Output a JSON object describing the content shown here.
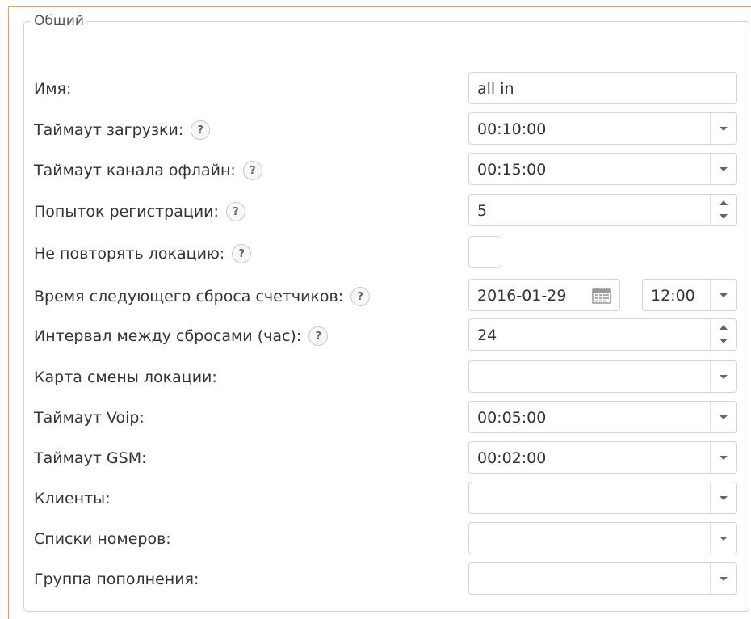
{
  "legend": "Общий",
  "fields": {
    "name": {
      "label": "Имя:",
      "value": "all in"
    },
    "load_timeout": {
      "label": "Таймаут загрузки:",
      "help": "?",
      "value": "00:10:00"
    },
    "channel_offline_timeout": {
      "label": "Таймаут канала офлайн:",
      "help": "?",
      "value": "00:15:00"
    },
    "registration_attempts": {
      "label": "Попыток регистрации:",
      "help": "?",
      "value": "5"
    },
    "no_repeat_location": {
      "label": "Не повторять локацию:",
      "help": "?",
      "checked": false
    },
    "next_counter_reset": {
      "label": "Время следующего сброса счетчиков:",
      "help": "?",
      "date": "2016-01-29",
      "time": "12:00"
    },
    "reset_interval": {
      "label": "Интервал между сбросами (час):",
      "help": "?",
      "value": "24"
    },
    "location_change_map": {
      "label": "Карта смены локации:",
      "value": ""
    },
    "voip_timeout": {
      "label": "Таймаут Voip:",
      "value": "00:05:00"
    },
    "gsm_timeout": {
      "label": "Таймаут GSM:",
      "value": "00:02:00"
    },
    "clients": {
      "label": "Клиенты:",
      "value": ""
    },
    "number_lists": {
      "label": "Списки номеров:",
      "value": ""
    },
    "top_up_group": {
      "label": "Группа пополнения:",
      "value": ""
    }
  },
  "icons": {
    "help": "question-circle-icon",
    "dropdown": "chevron-down-icon",
    "spinner": "spinner-arrows-icon",
    "calendar": "calendar-icon"
  },
  "colors": {
    "outer_border": "#e8a33a",
    "fieldset_border": "#cfcfcf",
    "text": "#333333"
  }
}
